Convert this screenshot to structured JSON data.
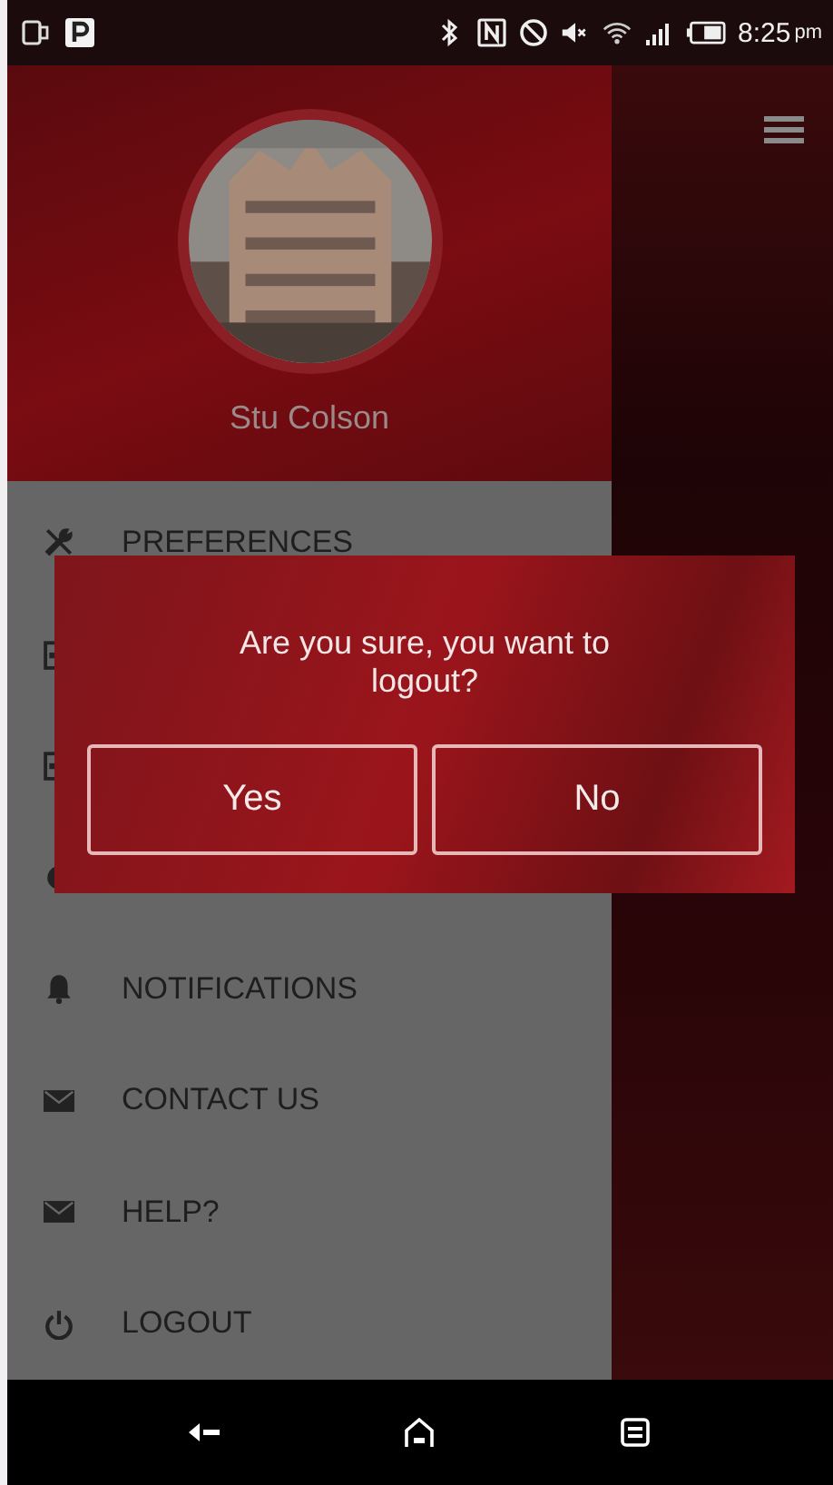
{
  "status_bar": {
    "time": "8:25",
    "ampm": "pm"
  },
  "profile": {
    "name": "Stu Colson"
  },
  "menu": [
    {
      "kind": "item",
      "label": "PREFERENCES"
    },
    {
      "kind": "covered"
    },
    {
      "kind": "covered"
    },
    {
      "kind": "covered"
    },
    {
      "kind": "item",
      "label": "NOTIFICATIONS"
    },
    {
      "kind": "item",
      "label": "CONTACT US"
    },
    {
      "kind": "item",
      "label": "HELP?"
    },
    {
      "kind": "item",
      "label": "LOGOUT"
    }
  ],
  "dialog": {
    "message": "Are you sure, you want to logout?",
    "buttons": [
      "Yes",
      "No"
    ]
  }
}
